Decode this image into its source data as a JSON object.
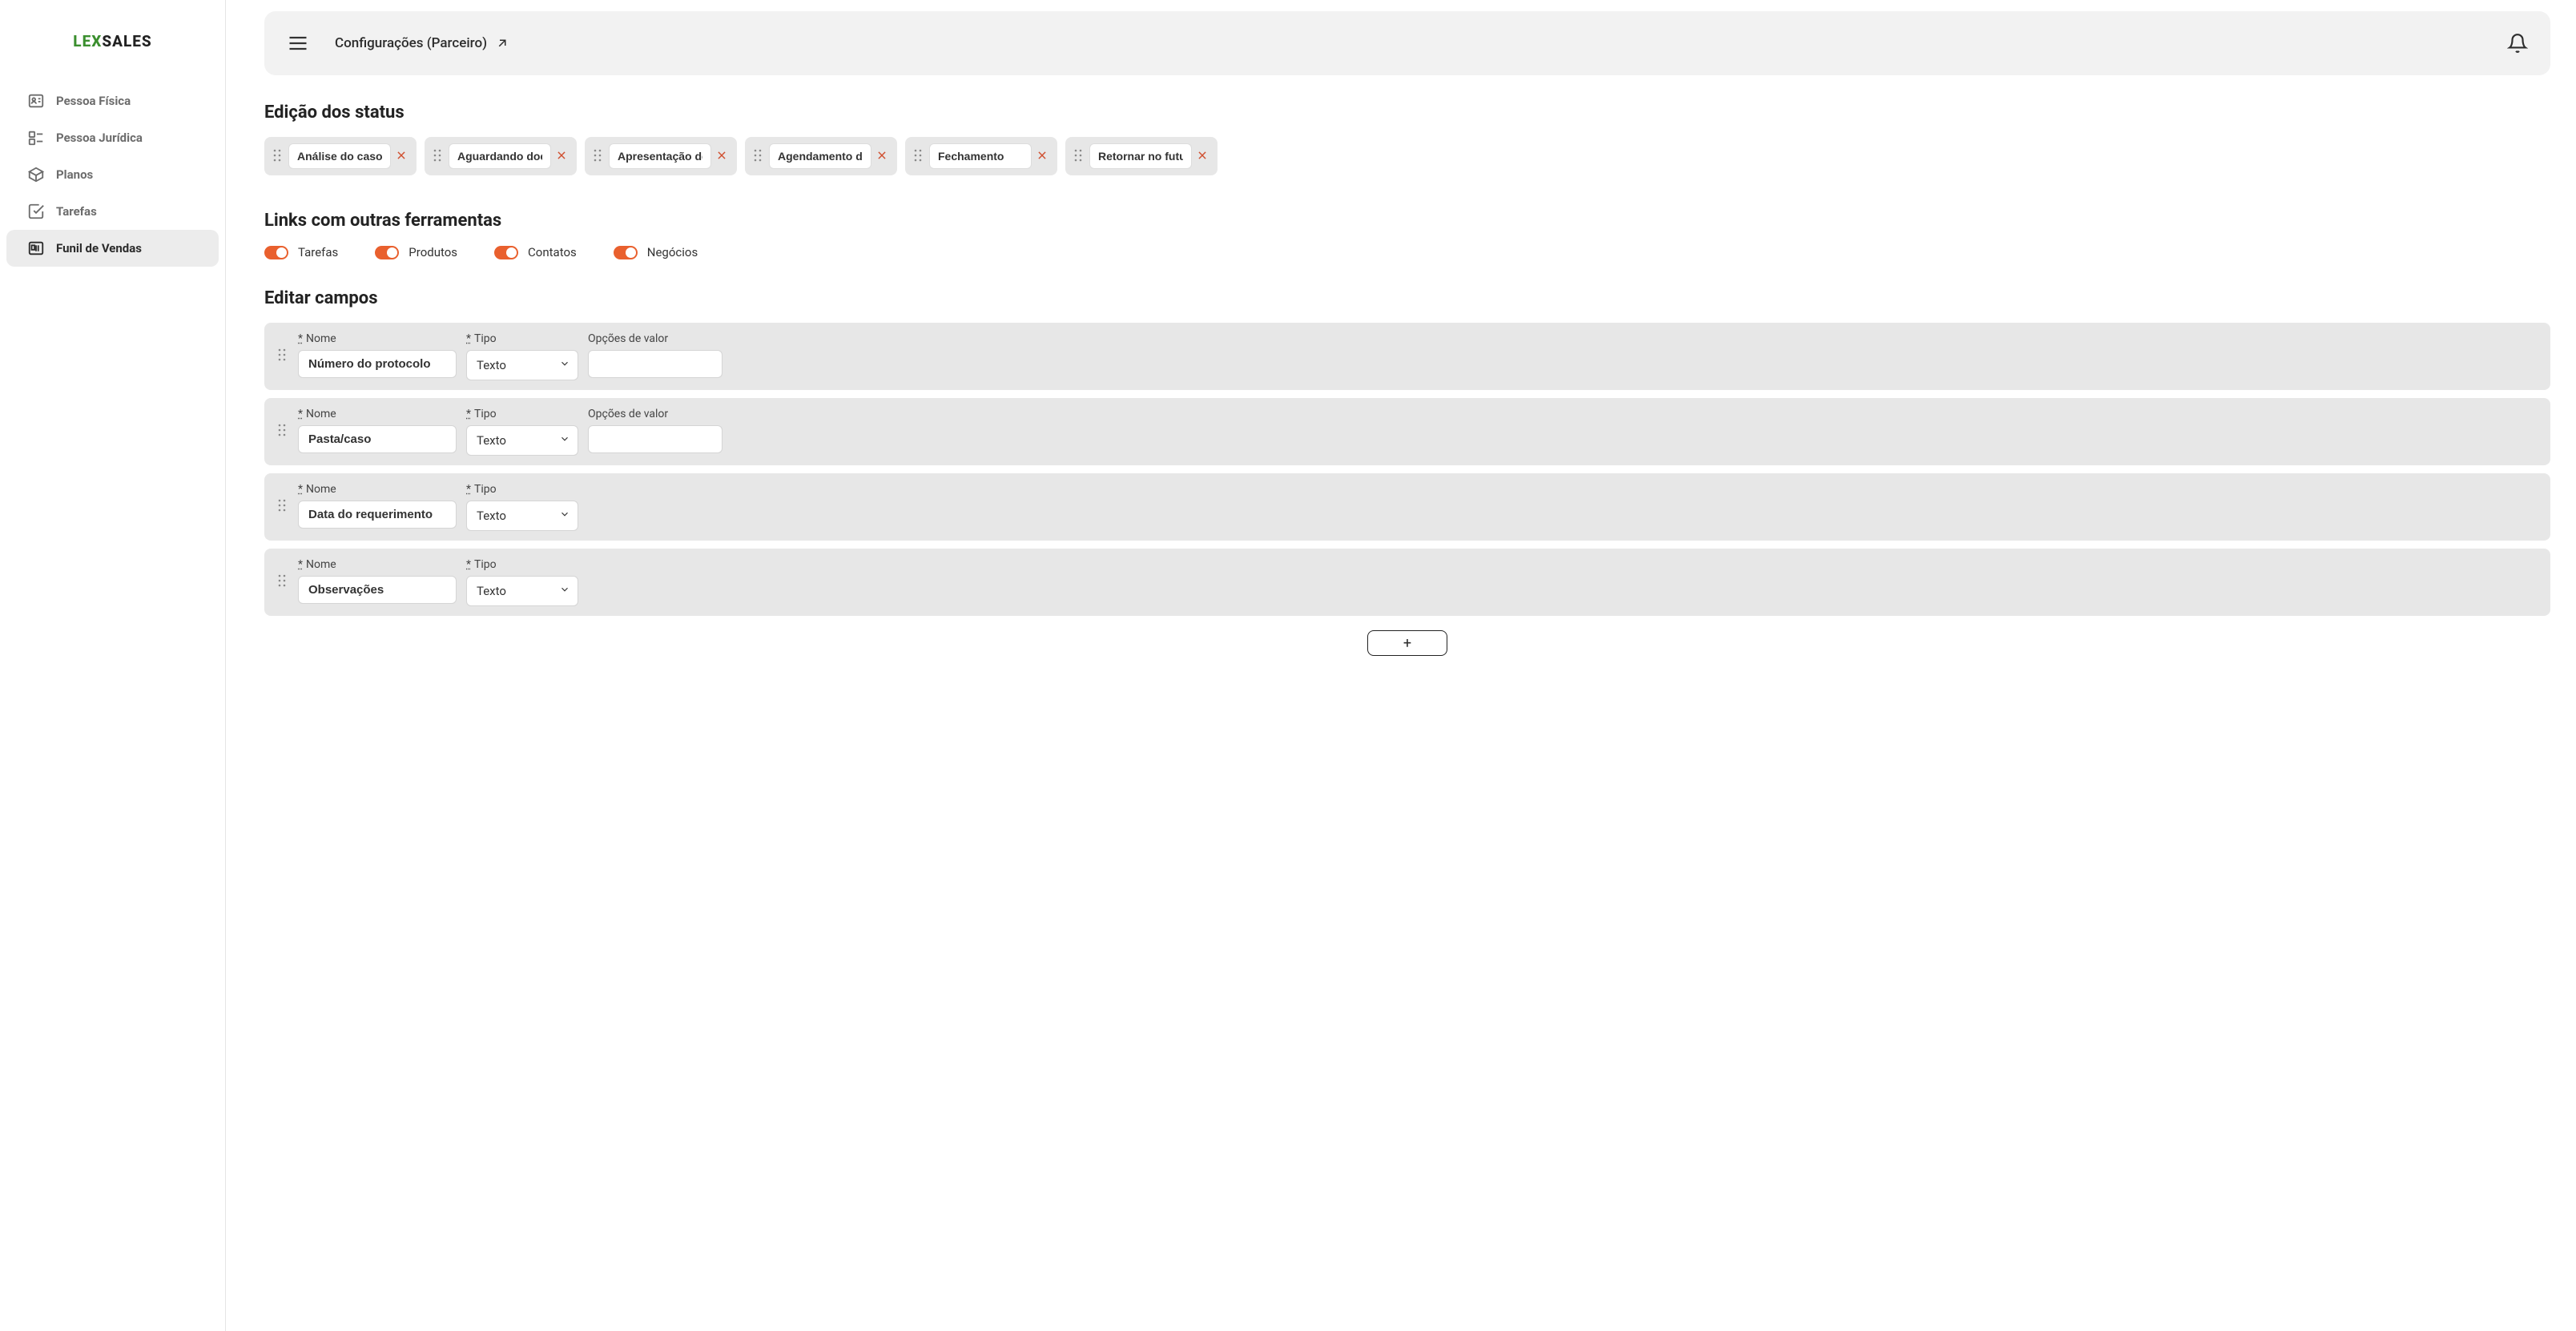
{
  "brand": {
    "lex": "LEX",
    "sales": "SALES"
  },
  "sidebar": {
    "items": [
      {
        "label": "Pessoa Física",
        "icon": "user-card-icon",
        "active": false
      },
      {
        "label": "Pessoa Jurídica",
        "icon": "company-icon",
        "active": false
      },
      {
        "label": "Planos",
        "icon": "box-icon",
        "active": false
      },
      {
        "label": "Tarefas",
        "icon": "check-square-icon",
        "active": false
      },
      {
        "label": "Funil de Vendas",
        "icon": "funnel-icon",
        "active": true
      }
    ]
  },
  "header": {
    "title": "Configurações (Parceiro)"
  },
  "sections": {
    "status_title": "Edição dos status",
    "links_title": "Links com outras ferramentas",
    "fields_title": "Editar campos"
  },
  "statuses": [
    "Análise do caso",
    "Aguardando documentos",
    "Apresentação de proposta",
    "Agendamento de reunião",
    "Fechamento",
    "Retornar no futuro"
  ],
  "toggles": [
    {
      "label": "Tarefas",
      "on": true
    },
    {
      "label": "Produtos",
      "on": true
    },
    {
      "label": "Contatos",
      "on": true
    },
    {
      "label": "Negócios",
      "on": true
    }
  ],
  "field_labels": {
    "name": "Nome",
    "type": "Tipo",
    "options": "Opções de valor",
    "asterisk": "*"
  },
  "type_options": [
    "Texto"
  ],
  "fields": [
    {
      "name": "Número do protocolo",
      "type": "Texto",
      "show_options": true
    },
    {
      "name": "Pasta/caso",
      "type": "Texto",
      "show_options": true
    },
    {
      "name": "Data do requerimento",
      "type": "Texto",
      "show_options": false
    },
    {
      "name": "Observações",
      "type": "Texto",
      "show_options": false
    }
  ],
  "add_button": "+"
}
